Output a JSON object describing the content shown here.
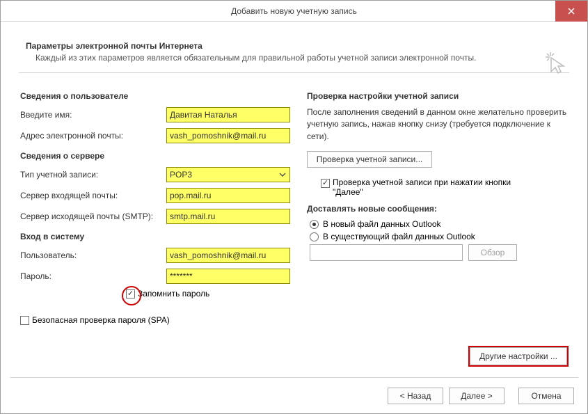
{
  "window": {
    "title": "Добавить новую учетную запись"
  },
  "header": {
    "title": "Параметры электронной почты Интернета",
    "subtitle": "Каждый из этих параметров является обязательным для правильной работы учетной записи электронной почты."
  },
  "left": {
    "user_section": "Сведения о пользователе",
    "name_label": "Введите имя:",
    "name_value": "Давитая Наталья",
    "email_label": "Адрес электронной почты:",
    "email_value": "vash_pomoshnik@mail.ru",
    "server_section": "Сведения о сервере",
    "account_type_label": "Тип учетной записи:",
    "account_type_value": "POP3",
    "incoming_label": "Сервер входящей почты:",
    "incoming_value": "pop.mail.ru",
    "outgoing_label": "Сервер исходящей почты (SMTP):",
    "outgoing_value": "smtp.mail.ru",
    "login_section": "Вход в систему",
    "user_label": "Пользователь:",
    "user_value": "vash_pomoshnik@mail.ru",
    "pass_label": "Пароль:",
    "pass_value": "*******",
    "remember_label": "Запомнить пароль",
    "spa_label": "Безопасная проверка пароля (SPA)"
  },
  "right": {
    "test_section": "Проверка настройки учетной записи",
    "test_desc": "После заполнения сведений в данном окне желательно проверить учетную запись, нажав кнопку снизу (требуется подключение к сети).",
    "test_button": "Проверка учетной записи...",
    "test_on_next": "Проверка учетной записи при нажатии кнопки \"Далее\"",
    "deliver_section": "Доставлять новые сообщения:",
    "radio_new": "В новый файл данных Outlook",
    "radio_existing": "В существующий файл данных Outlook",
    "browse": "Обзор",
    "more_settings": "Другие настройки ..."
  },
  "bottom": {
    "back": "< Назад",
    "next": "Далее >",
    "cancel": "Отмена"
  }
}
